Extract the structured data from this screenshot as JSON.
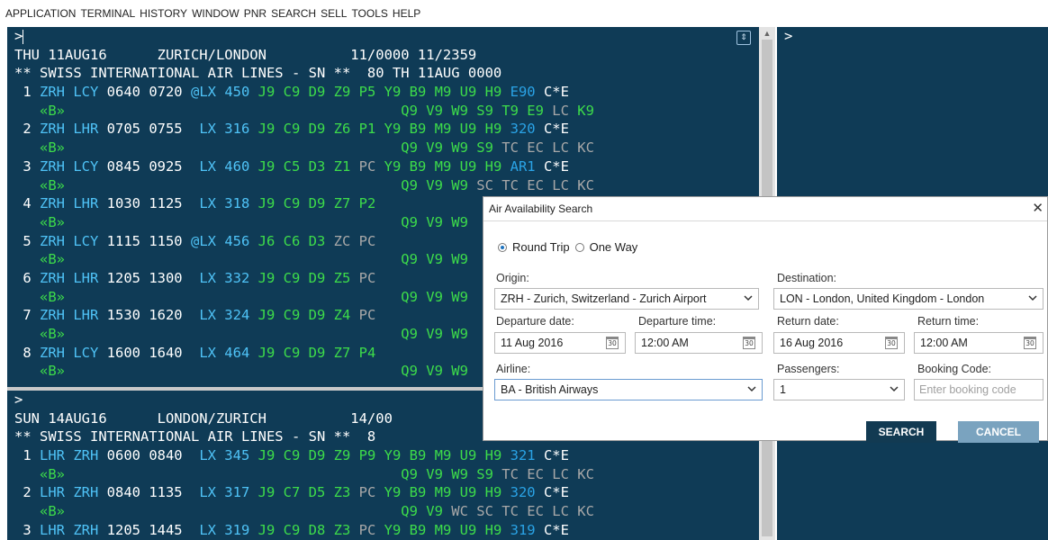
{
  "menu": [
    "APPLICATION",
    "TERMINAL",
    "HISTORY",
    "WINDOW",
    "PNR",
    "SEARCH",
    "SELL",
    "TOOLS",
    "HELP"
  ],
  "terminal1": {
    "prompt": ">",
    "lines": [
      [
        {
          "t": "THU 11AUG16      ZURICH/LONDON          11/0000 11/2359",
          "c": "w"
        }
      ],
      [
        {
          "t": "** SWISS INTERNATIONAL AIR LINES - SN **  80 TH 11AUG 0000",
          "c": "w"
        }
      ],
      [
        {
          "t": " 1 ",
          "c": "w"
        },
        {
          "t": "ZRH LCY ",
          "c": "c"
        },
        {
          "t": "0640 0720 ",
          "c": "w"
        },
        {
          "t": "@",
          "c": "c"
        },
        {
          "t": "LX 450 ",
          "c": "c"
        },
        {
          "t": "J9 C9 ",
          "c": "g"
        },
        {
          "t": "D9 Z9 P5 Y9 B9 M9 U9 H9 ",
          "c": "g"
        },
        {
          "t": "E90 ",
          "c": "b"
        },
        {
          "t": "C*E",
          "c": "w"
        }
      ],
      [
        {
          "t": "   «B»",
          "c": "g"
        },
        {
          "t": "                                        Q9 V9 W9 S9 T9 E9 ",
          "c": "g"
        },
        {
          "t": "LC ",
          "c": "y"
        },
        {
          "t": "K9",
          "c": "g"
        }
      ],
      [
        {
          "t": " 2 ",
          "c": "w"
        },
        {
          "t": "ZRH LHR ",
          "c": "c"
        },
        {
          "t": "0705 0755  ",
          "c": "w"
        },
        {
          "t": "LX 316 ",
          "c": "c"
        },
        {
          "t": "J9 C9 ",
          "c": "g"
        },
        {
          "t": "D9 Z6 P1 Y9 B9 M9 U9 H9 ",
          "c": "g"
        },
        {
          "t": "320 ",
          "c": "b"
        },
        {
          "t": "C*E",
          "c": "w"
        }
      ],
      [
        {
          "t": "   «B»",
          "c": "g"
        },
        {
          "t": "                                        Q9 V9 W9 S9 ",
          "c": "g"
        },
        {
          "t": "TC EC LC KC",
          "c": "y"
        }
      ],
      [
        {
          "t": " 3 ",
          "c": "w"
        },
        {
          "t": "ZRH LCY ",
          "c": "c"
        },
        {
          "t": "0845 0925  ",
          "c": "w"
        },
        {
          "t": "LX 460 ",
          "c": "c"
        },
        {
          "t": "J9 C5 ",
          "c": "g"
        },
        {
          "t": "D3 Z1 ",
          "c": "g"
        },
        {
          "t": "PC ",
          "c": "y"
        },
        {
          "t": "Y9 B9 M9 U9 H9 ",
          "c": "g"
        },
        {
          "t": "AR1 ",
          "c": "b"
        },
        {
          "t": "C*E",
          "c": "w"
        }
      ],
      [
        {
          "t": "   «B»",
          "c": "g"
        },
        {
          "t": "                                        Q9 V9 W9 ",
          "c": "g"
        },
        {
          "t": "SC TC EC LC KC",
          "c": "y"
        }
      ],
      [
        {
          "t": " 4 ",
          "c": "w"
        },
        {
          "t": "ZRH LHR ",
          "c": "c"
        },
        {
          "t": "1030 1125  ",
          "c": "w"
        },
        {
          "t": "LX 318 ",
          "c": "c"
        },
        {
          "t": "J9 C9 ",
          "c": "g"
        },
        {
          "t": "D9 Z7 P2",
          "c": "g"
        }
      ],
      [
        {
          "t": "   «B»",
          "c": "g"
        },
        {
          "t": "                                        Q9 V9 W9",
          "c": "g"
        }
      ],
      [
        {
          "t": " 5 ",
          "c": "w"
        },
        {
          "t": "ZRH LCY ",
          "c": "c"
        },
        {
          "t": "1115 1150 ",
          "c": "w"
        },
        {
          "t": "@",
          "c": "c"
        },
        {
          "t": "LX 456 ",
          "c": "c"
        },
        {
          "t": "J6 C6 ",
          "c": "g"
        },
        {
          "t": "D3 ",
          "c": "g"
        },
        {
          "t": "ZC PC",
          "c": "y"
        }
      ],
      [
        {
          "t": "   «B»",
          "c": "g"
        },
        {
          "t": "                                        Q9 V9 W9",
          "c": "g"
        }
      ],
      [
        {
          "t": " 6 ",
          "c": "w"
        },
        {
          "t": "ZRH LHR ",
          "c": "c"
        },
        {
          "t": "1205 1300  ",
          "c": "w"
        },
        {
          "t": "LX 332 ",
          "c": "c"
        },
        {
          "t": "J9 C9 ",
          "c": "g"
        },
        {
          "t": "D9 Z5 ",
          "c": "g"
        },
        {
          "t": "PC",
          "c": "y"
        }
      ],
      [
        {
          "t": "   «B»",
          "c": "g"
        },
        {
          "t": "                                        Q9 V9 W9",
          "c": "g"
        }
      ],
      [
        {
          "t": " 7 ",
          "c": "w"
        },
        {
          "t": "ZRH LHR ",
          "c": "c"
        },
        {
          "t": "1530 1620  ",
          "c": "w"
        },
        {
          "t": "LX 324 ",
          "c": "c"
        },
        {
          "t": "J9 C9 ",
          "c": "g"
        },
        {
          "t": "D9 Z4 ",
          "c": "g"
        },
        {
          "t": "PC",
          "c": "y"
        }
      ],
      [
        {
          "t": "   «B»",
          "c": "g"
        },
        {
          "t": "                                        Q9 V9 W9",
          "c": "g"
        }
      ],
      [
        {
          "t": " 8 ",
          "c": "w"
        },
        {
          "t": "ZRH LCY ",
          "c": "c"
        },
        {
          "t": "1600 1640  ",
          "c": "w"
        },
        {
          "t": "LX 464 ",
          "c": "c"
        },
        {
          "t": "J9 C9 ",
          "c": "g"
        },
        {
          "t": "D9 Z7 P4",
          "c": "g"
        }
      ],
      [
        {
          "t": "   «B»",
          "c": "g"
        },
        {
          "t": "                                        Q9 V9 W9",
          "c": "g"
        }
      ]
    ]
  },
  "terminal2": {
    "lines": [
      [
        {
          "t": ">",
          "c": "w"
        }
      ],
      [
        {
          "t": "SUN 14AUG16      LONDON/ZURICH          14/00",
          "c": "w"
        }
      ],
      [
        {
          "t": "** SWISS INTERNATIONAL AIR LINES - SN **  8",
          "c": "w"
        }
      ],
      [
        {
          "t": " 1 ",
          "c": "w"
        },
        {
          "t": "LHR ZRH ",
          "c": "c"
        },
        {
          "t": "0600 0840  ",
          "c": "w"
        },
        {
          "t": "LX 345 ",
          "c": "c"
        },
        {
          "t": "J9 C9 ",
          "c": "g"
        },
        {
          "t": "D9 Z9 P9 Y9 B9 M9 U9 H9 ",
          "c": "g"
        },
        {
          "t": "321 ",
          "c": "b"
        },
        {
          "t": "C*E",
          "c": "w"
        }
      ],
      [
        {
          "t": "   «B»",
          "c": "g"
        },
        {
          "t": "                                        Q9 V9 W9 S9 ",
          "c": "g"
        },
        {
          "t": "TC EC LC KC",
          "c": "y"
        }
      ],
      [
        {
          "t": " 2 ",
          "c": "w"
        },
        {
          "t": "LHR ZRH ",
          "c": "c"
        },
        {
          "t": "0840 1135  ",
          "c": "w"
        },
        {
          "t": "LX 317 ",
          "c": "c"
        },
        {
          "t": "J9 C7 ",
          "c": "g"
        },
        {
          "t": "D5 Z3 ",
          "c": "g"
        },
        {
          "t": "PC ",
          "c": "y"
        },
        {
          "t": "Y9 B9 M9 U9 H9 ",
          "c": "g"
        },
        {
          "t": "320 ",
          "c": "b"
        },
        {
          "t": "C*E",
          "c": "w"
        }
      ],
      [
        {
          "t": "   «B»",
          "c": "g"
        },
        {
          "t": "                                        Q9 V9 ",
          "c": "g"
        },
        {
          "t": "WC SC TC EC LC KC",
          "c": "y"
        }
      ],
      [
        {
          "t": " 3 ",
          "c": "w"
        },
        {
          "t": "LHR ZRH ",
          "c": "c"
        },
        {
          "t": "1205 1445  ",
          "c": "w"
        },
        {
          "t": "LX 319 ",
          "c": "c"
        },
        {
          "t": "J9 C9 ",
          "c": "g"
        },
        {
          "t": "D8 Z3 ",
          "c": "g"
        },
        {
          "t": "PC ",
          "c": "y"
        },
        {
          "t": "Y9 B9 M9 U9 H9 ",
          "c": "g"
        },
        {
          "t": "319 ",
          "c": "b"
        },
        {
          "t": "C*E",
          "c": "w"
        }
      ]
    ]
  },
  "terminal3": {
    "prompt": ">"
  },
  "dialog": {
    "title": "Air Availability Search",
    "close": "✕",
    "trip_round": "Round Trip",
    "trip_oneway": "One Way",
    "origin_label": "Origin:",
    "origin_value": "ZRH - Zurich, Switzerland - Zurich Airport",
    "destination_label": "Destination:",
    "destination_value": "LON - London, United Kingdom - London",
    "departure_date_label": "Departure date:",
    "departure_date": "11 Aug 2016",
    "departure_time_label": "Departure time:",
    "departure_time": "12:00 AM",
    "return_date_label": "Return date:",
    "return_date": "16 Aug 2016",
    "return_time_label": "Return time:",
    "return_time": "12:00 AM",
    "airline_label": "Airline:",
    "airline_value": "BA - British Airways",
    "passengers_label": "Passengers:",
    "passengers_value": "1",
    "booking_label": "Booking Code:",
    "booking_placeholder": "Enter booking code",
    "calendar_glyph": "30",
    "search": "SEARCH",
    "cancel": "CANCEL"
  },
  "colors": {
    "terminal_bg": "#0f3b56",
    "search_btn": "#123a52",
    "cancel_btn": "#7aa3bf"
  }
}
